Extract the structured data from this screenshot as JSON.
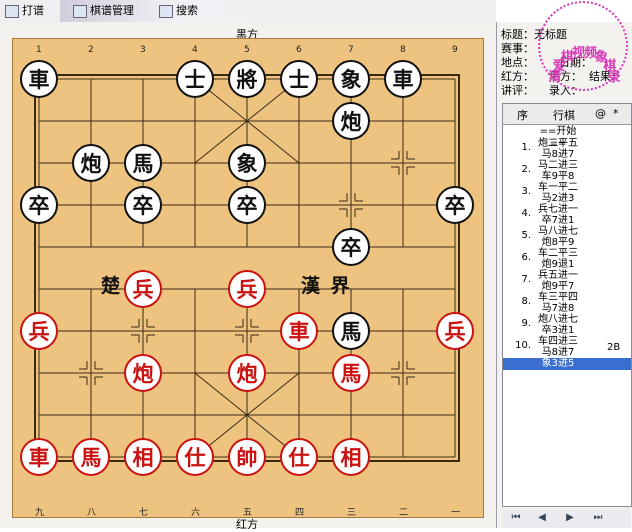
{
  "toolbar": {
    "items": [
      "打谱",
      "棋谱管理",
      "搜索"
    ]
  },
  "board": {
    "black_side_label": "黑方",
    "red_side_label": "红方",
    "top_files": [
      "1",
      "2",
      "3",
      "4",
      "5",
      "6",
      "7",
      "8",
      "9"
    ],
    "bottom_files": [
      "九",
      "八",
      "七",
      "六",
      "五",
      "四",
      "三",
      "二",
      "一"
    ],
    "river_left": "楚  河",
    "river_right": "漢  界",
    "pieces": [
      {
        "char": "車",
        "side": "black",
        "file": 0,
        "rank": 0
      },
      {
        "char": "士",
        "side": "black",
        "file": 3,
        "rank": 0
      },
      {
        "char": "將",
        "side": "black",
        "file": 4,
        "rank": 0
      },
      {
        "char": "士",
        "side": "black",
        "file": 5,
        "rank": 0
      },
      {
        "char": "象",
        "side": "black",
        "file": 6,
        "rank": 0
      },
      {
        "char": "車",
        "side": "black",
        "file": 7,
        "rank": 0
      },
      {
        "char": "炮",
        "side": "black",
        "file": 6,
        "rank": 1
      },
      {
        "char": "炮",
        "side": "black",
        "file": 1,
        "rank": 2
      },
      {
        "char": "馬",
        "side": "black",
        "file": 2,
        "rank": 2
      },
      {
        "char": "象",
        "side": "black",
        "file": 4,
        "rank": 2
      },
      {
        "char": "卒",
        "side": "black",
        "file": 0,
        "rank": 3
      },
      {
        "char": "卒",
        "side": "black",
        "file": 2,
        "rank": 3
      },
      {
        "char": "卒",
        "side": "black",
        "file": 4,
        "rank": 3
      },
      {
        "char": "卒",
        "side": "black",
        "file": 8,
        "rank": 3
      },
      {
        "char": "卒",
        "side": "black",
        "file": 6,
        "rank": 4
      },
      {
        "char": "兵",
        "side": "red",
        "file": 2,
        "rank": 5
      },
      {
        "char": "兵",
        "side": "red",
        "file": 4,
        "rank": 5
      },
      {
        "char": "兵",
        "side": "red",
        "file": 0,
        "rank": 6
      },
      {
        "char": "車",
        "side": "red",
        "file": 5,
        "rank": 6
      },
      {
        "char": "馬",
        "side": "black",
        "file": 6,
        "rank": 6
      },
      {
        "char": "兵",
        "side": "red",
        "file": 8,
        "rank": 6
      },
      {
        "char": "炮",
        "side": "red",
        "file": 2,
        "rank": 7
      },
      {
        "char": "炮",
        "side": "red",
        "file": 4,
        "rank": 7
      },
      {
        "char": "馬",
        "side": "red",
        "file": 6,
        "rank": 7
      },
      {
        "char": "車",
        "side": "red",
        "file": 0,
        "rank": 9
      },
      {
        "char": "馬",
        "side": "red",
        "file": 1,
        "rank": 9
      },
      {
        "char": "相",
        "side": "red",
        "file": 2,
        "rank": 9
      },
      {
        "char": "仕",
        "side": "red",
        "file": 3,
        "rank": 9
      },
      {
        "char": "帥",
        "side": "red",
        "file": 4,
        "rank": 9
      },
      {
        "char": "仕",
        "side": "red",
        "file": 5,
        "rank": 9
      },
      {
        "char": "相",
        "side": "red",
        "file": 6,
        "rank": 9
      }
    ]
  },
  "info": {
    "title_label": "标题：",
    "title_value": "无标题",
    "event_label": "赛事：",
    "place_label": "地点：",
    "date_label": "日期：",
    "red_label": "红方：",
    "black_label": "黑方：",
    "result_label": "结果：",
    "commentator_label": "讲评：",
    "recorder_label": "录入："
  },
  "movelist": {
    "headers": [
      "序",
      "行棋",
      "@",
      "*"
    ],
    "start": "==开始==",
    "moves": [
      {
        "num": "1.",
        "red": "炮二平五",
        "black": "马8进7"
      },
      {
        "num": "2.",
        "red": "马二进三",
        "black": "车9平8"
      },
      {
        "num": "3.",
        "red": "车一平二",
        "black": "马2进3"
      },
      {
        "num": "4.",
        "red": "兵七进一",
        "black": "卒7进1"
      },
      {
        "num": "5.",
        "red": "马八进七",
        "black": "炮8平9"
      },
      {
        "num": "6.",
        "red": "车二平三",
        "black": "炮9退1"
      },
      {
        "num": "7.",
        "red": "兵五进一",
        "black": "炮9平7"
      },
      {
        "num": "8.",
        "red": "车三平四",
        "black": "马7进8"
      },
      {
        "num": "9.",
        "red": "炮八进七",
        "black": "卒3进1"
      },
      {
        "num": "10.",
        "red": "车四进三",
        "black": "马8进7",
        "extra": "2B"
      }
    ],
    "selected": "象3进5"
  },
  "seal": {
    "chars": [
      "清",
      "爱",
      "棋",
      "视",
      "频",
      "象",
      "棋",
      "录"
    ]
  }
}
